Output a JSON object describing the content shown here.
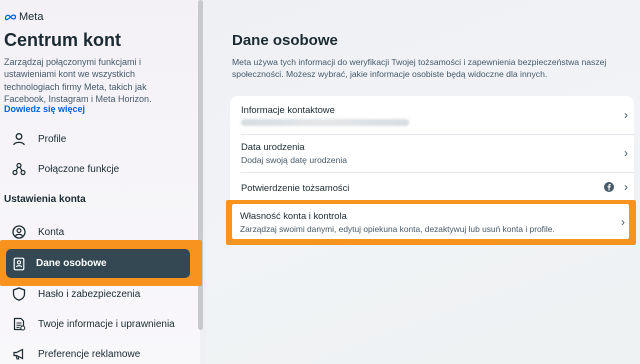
{
  "sidebar": {
    "brand": "Meta",
    "title": "Centrum kont",
    "description": "Zarządzaj połączonymi funkcjami i ustawieniami kont we wszystkich technologiach firmy Meta, takich jak Facebook, Instagram i Meta Horizon.",
    "link": "Dowiedz się więcej",
    "items_top": [
      {
        "label": "Profile",
        "icon": "profile-icon"
      },
      {
        "label": "Połączone funkcje",
        "icon": "connected-features-icon"
      }
    ],
    "section_title": "Ustawienia konta",
    "items_settings": [
      {
        "label": "Konta",
        "icon": "account-icon"
      },
      {
        "label": "Dane osobowe",
        "icon": "id-card-icon",
        "active": true
      },
      {
        "label": "Hasło i zabezpieczenia",
        "icon": "shield-icon"
      },
      {
        "label": "Twoje informacje i uprawnienia",
        "icon": "document-icon"
      },
      {
        "label": "Preferencje reklamowe",
        "icon": "megaphone-icon"
      }
    ]
  },
  "main": {
    "title": "Dane osobowe",
    "description": "Meta używa tych informacji do weryfikacji Twojej tożsamości i zapewnienia bezpieczeństwa naszej społeczności. Możesz wybrać, jakie informacje osobiste będą widoczne dla innych.",
    "rows": [
      {
        "label": "Informacje kontaktowe",
        "sub": ""
      },
      {
        "label": "Data urodzenia",
        "sub": "Dodaj swoją datę urodzenia"
      },
      {
        "label": "Potwierdzenie tożsamości",
        "sub": ""
      },
      {
        "label": "Własność konta i kontrola",
        "sub": "Zarządzaj swoimi danymi, edytuj opiekuna konta, dezaktywuj lub usuń konta i profile."
      }
    ]
  },
  "colors": {
    "accent": "#0064e0",
    "highlight": "#f7931e",
    "active_bg": "#344854"
  }
}
